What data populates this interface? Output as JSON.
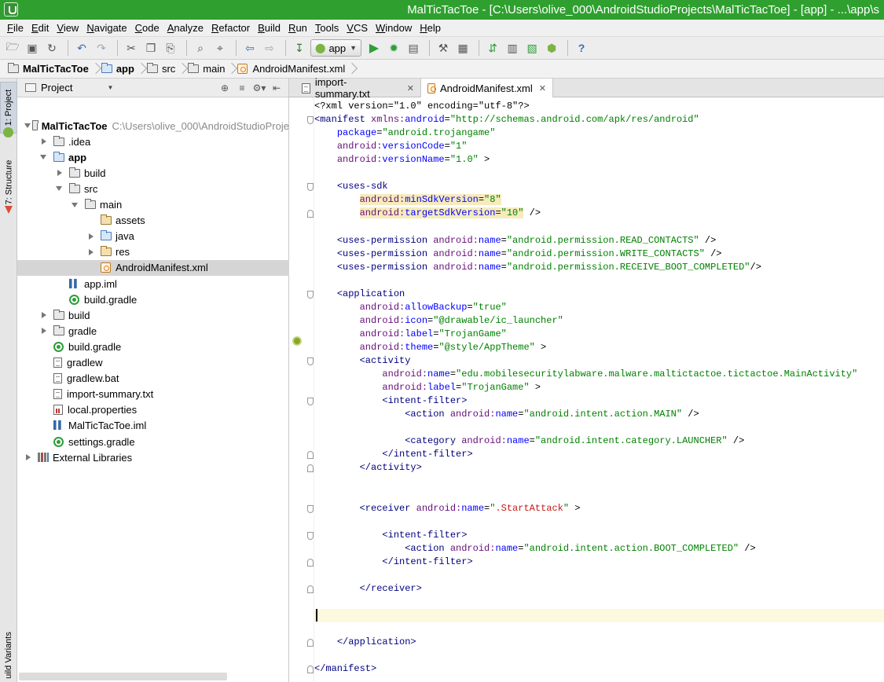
{
  "window": {
    "title": "MalTicTacToe - [C:\\Users\\olive_000\\AndroidStudioProjects\\MalTicTacToe] - [app] - ...\\app\\s"
  },
  "menu": [
    "File",
    "Edit",
    "View",
    "Navigate",
    "Code",
    "Analyze",
    "Refactor",
    "Build",
    "Run",
    "Tools",
    "VCS",
    "Window",
    "Help"
  ],
  "toolbar": {
    "run_config": "app",
    "icons": [
      "folder-open",
      "save",
      "sync",
      "undo",
      "redo",
      "cut",
      "copy",
      "paste",
      "find",
      "replace",
      "back",
      "forward",
      "make",
      "android-config",
      "run",
      "debug",
      "attach-debugger",
      "project-structure",
      "sdk-manager",
      "avd-manager",
      "sync-gradle",
      "device-monitor",
      "android-icon",
      "help"
    ]
  },
  "breadcrumb": [
    "MalTicTacToe",
    "app",
    "src",
    "main",
    "AndroidManifest.xml"
  ],
  "side_stripe": {
    "project_tab": "1: Project",
    "structure_tab": "7: Structure",
    "build_variants_tab": "uild Variants"
  },
  "project_panel": {
    "header": "Project",
    "tree": [
      {
        "label": "MalTicTacToe",
        "path": "C:\\Users\\olive_000\\AndroidStudioProje",
        "icon": "project-folder",
        "bold": true,
        "expanded": true,
        "depth": 0
      },
      {
        "label": ".idea",
        "icon": "folder",
        "expanded": false,
        "depth": 1
      },
      {
        "label": "app",
        "icon": "module-folder",
        "bold": true,
        "expanded": true,
        "depth": 1
      },
      {
        "label": "build",
        "icon": "folder",
        "expanded": false,
        "depth": 2
      },
      {
        "label": "src",
        "icon": "folder",
        "expanded": true,
        "depth": 2
      },
      {
        "label": "main",
        "icon": "folder",
        "expanded": true,
        "depth": 3
      },
      {
        "label": "assets",
        "icon": "res-folder",
        "depth": 4
      },
      {
        "label": "java",
        "icon": "source-folder",
        "expanded": false,
        "depth": 4
      },
      {
        "label": "res",
        "icon": "res-folder",
        "expanded": false,
        "depth": 4
      },
      {
        "label": "AndroidManifest.xml",
        "icon": "xml-file",
        "depth": 4,
        "selected": true
      },
      {
        "label": "app.iml",
        "icon": "iml-file",
        "depth": 2
      },
      {
        "label": "build.gradle",
        "icon": "gradle-file",
        "depth": 2
      },
      {
        "label": "build",
        "icon": "folder",
        "expanded": false,
        "depth": 1
      },
      {
        "label": "gradle",
        "icon": "folder",
        "expanded": false,
        "depth": 1
      },
      {
        "label": "build.gradle",
        "icon": "gradle-file",
        "depth": 1
      },
      {
        "label": "gradlew",
        "icon": "text-file",
        "depth": 1
      },
      {
        "label": "gradlew.bat",
        "icon": "text-file",
        "depth": 1
      },
      {
        "label": "import-summary.txt",
        "icon": "text-file",
        "depth": 1
      },
      {
        "label": "local.properties",
        "icon": "properties-file",
        "depth": 1
      },
      {
        "label": "MalTicTacToe.iml",
        "icon": "iml-file",
        "depth": 1
      },
      {
        "label": "settings.gradle",
        "icon": "gradle-file",
        "depth": 1
      },
      {
        "label": "External Libraries",
        "icon": "libraries",
        "expanded": false,
        "depth": 0
      }
    ]
  },
  "editor": {
    "tabs": [
      {
        "label": "import-summary.txt",
        "icon": "text-file",
        "active": false
      },
      {
        "label": "AndroidManifest.xml",
        "icon": "xml-file",
        "active": true
      }
    ],
    "caret_line": 38,
    "lines": [
      [
        [
          "plain",
          "<?xml version=\"1.0\" encoding=\"utf-8\"?>"
        ]
      ],
      [
        [
          "tag",
          "<manifest "
        ],
        [
          "ns",
          "xmlns:"
        ],
        [
          "attr",
          "android"
        ],
        [
          "plain",
          "="
        ],
        [
          "str",
          "\"http://schemas.android.com/apk/res/android\""
        ]
      ],
      [
        [
          "plain",
          "    "
        ],
        [
          "attr",
          "package"
        ],
        [
          "plain",
          "="
        ],
        [
          "str",
          "\"android.trojangame\""
        ]
      ],
      [
        [
          "plain",
          "    "
        ],
        [
          "ns",
          "android:"
        ],
        [
          "attr",
          "versionCode"
        ],
        [
          "plain",
          "="
        ],
        [
          "str",
          "\"1\""
        ]
      ],
      [
        [
          "plain",
          "    "
        ],
        [
          "ns",
          "android:"
        ],
        [
          "attr",
          "versionName"
        ],
        [
          "plain",
          "="
        ],
        [
          "str",
          "\"1.0\""
        ],
        [
          "plain",
          " >"
        ]
      ],
      [],
      [
        [
          "plain",
          "    "
        ],
        [
          "tag",
          "<uses-sdk"
        ]
      ],
      [
        [
          "plain",
          "        "
        ],
        [
          "hl-ns",
          "android:"
        ],
        [
          "hl-attr",
          "minSdkVersion"
        ],
        [
          "hl-plain",
          "="
        ],
        [
          "hl-str",
          "\"8\""
        ]
      ],
      [
        [
          "plain",
          "        "
        ],
        [
          "hl-ns",
          "android:"
        ],
        [
          "hl-attr",
          "targetSdkVersion"
        ],
        [
          "hl-plain",
          "="
        ],
        [
          "hl-str",
          "\"10\""
        ],
        [
          "plain",
          " />"
        ]
      ],
      [],
      [
        [
          "plain",
          "    "
        ],
        [
          "tag",
          "<uses-permission "
        ],
        [
          "ns",
          "android:"
        ],
        [
          "attr",
          "name"
        ],
        [
          "plain",
          "="
        ],
        [
          "str",
          "\"android.permission.READ_CONTACTS\""
        ],
        [
          "plain",
          " />"
        ]
      ],
      [
        [
          "plain",
          "    "
        ],
        [
          "tag",
          "<uses-permission "
        ],
        [
          "ns",
          "android:"
        ],
        [
          "attr",
          "name"
        ],
        [
          "plain",
          "="
        ],
        [
          "str",
          "\"android.permission.WRITE_CONTACTS\""
        ],
        [
          "plain",
          " />"
        ]
      ],
      [
        [
          "plain",
          "    "
        ],
        [
          "tag",
          "<uses-permission "
        ],
        [
          "ns",
          "android:"
        ],
        [
          "attr",
          "name"
        ],
        [
          "plain",
          "="
        ],
        [
          "str",
          "\"android.permission.RECEIVE_BOOT_COMPLETED\""
        ],
        [
          "plain",
          "/>"
        ]
      ],
      [],
      [
        [
          "plain",
          "    "
        ],
        [
          "tag",
          "<application"
        ]
      ],
      [
        [
          "plain",
          "        "
        ],
        [
          "ns",
          "android:"
        ],
        [
          "attr",
          "allowBackup"
        ],
        [
          "plain",
          "="
        ],
        [
          "str",
          "\"true\""
        ]
      ],
      [
        [
          "plain",
          "        "
        ],
        [
          "ns",
          "android:"
        ],
        [
          "attr",
          "icon"
        ],
        [
          "plain",
          "="
        ],
        [
          "str",
          "\"@drawable/ic_launcher\""
        ]
      ],
      [
        [
          "plain",
          "        "
        ],
        [
          "ns",
          "android:"
        ],
        [
          "attr",
          "label"
        ],
        [
          "plain",
          "="
        ],
        [
          "str",
          "\"TrojanGame\""
        ]
      ],
      [
        [
          "plain",
          "        "
        ],
        [
          "ns",
          "android:"
        ],
        [
          "attr",
          "theme"
        ],
        [
          "plain",
          "="
        ],
        [
          "str",
          "\"@style/AppTheme\""
        ],
        [
          "plain",
          " >"
        ]
      ],
      [
        [
          "plain",
          "        "
        ],
        [
          "tag",
          "<activity"
        ]
      ],
      [
        [
          "plain",
          "            "
        ],
        [
          "ns",
          "android:"
        ],
        [
          "attr",
          "name"
        ],
        [
          "plain",
          "="
        ],
        [
          "str",
          "\"edu.mobilesecuritylabware.malware.maltictactoe.tictactoe.MainActivity\""
        ]
      ],
      [
        [
          "plain",
          "            "
        ],
        [
          "ns",
          "android:"
        ],
        [
          "attr",
          "label"
        ],
        [
          "plain",
          "="
        ],
        [
          "str",
          "\"TrojanGame\""
        ],
        [
          "plain",
          " >"
        ]
      ],
      [
        [
          "plain",
          "            "
        ],
        [
          "tag",
          "<intent-filter>"
        ]
      ],
      [
        [
          "plain",
          "                "
        ],
        [
          "tag",
          "<action "
        ],
        [
          "ns",
          "android:"
        ],
        [
          "attr",
          "name"
        ],
        [
          "plain",
          "="
        ],
        [
          "str",
          "\"android.intent.action.MAIN\""
        ],
        [
          "plain",
          " />"
        ]
      ],
      [],
      [
        [
          "plain",
          "                "
        ],
        [
          "tag",
          "<category "
        ],
        [
          "ns",
          "android:"
        ],
        [
          "attr",
          "name"
        ],
        [
          "plain",
          "="
        ],
        [
          "str",
          "\"android.intent.category.LAUNCHER\""
        ],
        [
          "plain",
          " />"
        ]
      ],
      [
        [
          "plain",
          "            "
        ],
        [
          "tag",
          "</intent-filter>"
        ]
      ],
      [
        [
          "plain",
          "        "
        ],
        [
          "tag",
          "</activity>"
        ]
      ],
      [],
      [],
      [
        [
          "plain",
          "        "
        ],
        [
          "tag",
          "<receiver "
        ],
        [
          "ns",
          "android:"
        ],
        [
          "attr",
          "name"
        ],
        [
          "plain",
          "="
        ],
        [
          "str",
          "\""
        ],
        [
          "red",
          ".StartAttack"
        ],
        [
          "str",
          "\""
        ],
        [
          "plain",
          " >"
        ]
      ],
      [],
      [
        [
          "plain",
          "            "
        ],
        [
          "tag",
          "<intent-filter>"
        ]
      ],
      [
        [
          "plain",
          "                "
        ],
        [
          "tag",
          "<action "
        ],
        [
          "ns",
          "android:"
        ],
        [
          "attr",
          "name"
        ],
        [
          "plain",
          "="
        ],
        [
          "str",
          "\"android.intent.action.BOOT_COMPLETED\""
        ],
        [
          "plain",
          " />"
        ]
      ],
      [
        [
          "plain",
          "            "
        ],
        [
          "tag",
          "</intent-filter>"
        ]
      ],
      [],
      [
        [
          "plain",
          "        "
        ],
        [
          "tag",
          "</receiver>"
        ]
      ],
      [],
      [],
      [],
      [
        [
          "plain",
          "    "
        ],
        [
          "tag",
          "</application>"
        ]
      ],
      [],
      [
        [
          "tag",
          "</manifest>"
        ]
      ]
    ]
  }
}
